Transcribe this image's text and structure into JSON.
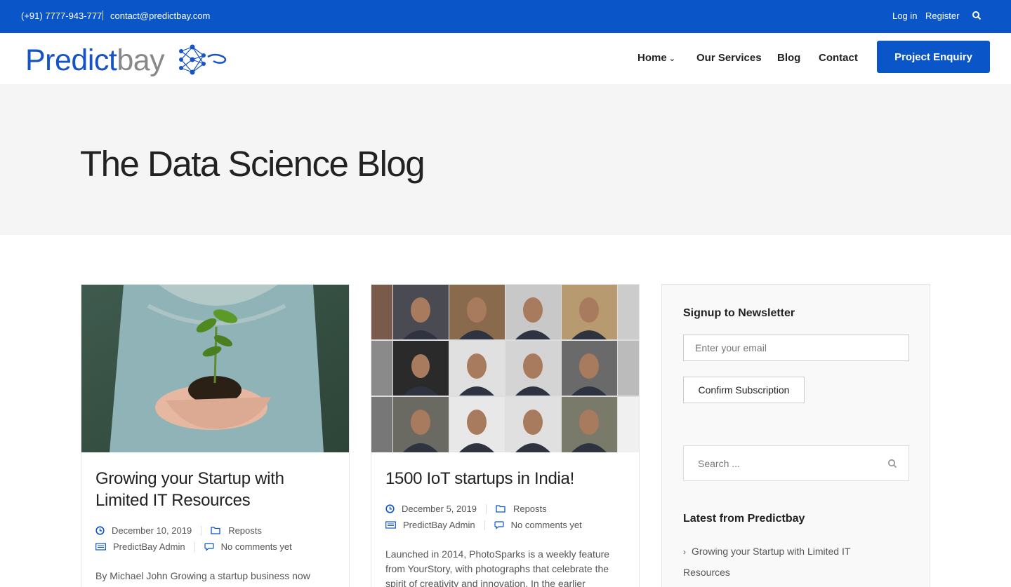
{
  "topbar": {
    "phone": "(+91) 7777-943-777",
    "email": "contact@predictbay.com",
    "login": "Log in",
    "register": "Register"
  },
  "header": {
    "logo_part1": "Predict",
    "logo_part2": "bay",
    "nav": {
      "home": "Home",
      "services": "Our Services",
      "blog": "Blog",
      "contact": "Contact"
    },
    "cta": "Project Enquiry"
  },
  "hero": {
    "title": "The Data Science Blog"
  },
  "posts": [
    {
      "title": "Growing your Startup with Limited IT Resources",
      "date": "December 10, 2019",
      "category": "Reposts",
      "author": "PredictBay Admin",
      "comments": "No comments yet",
      "excerpt": "By Michael John Growing a startup business now"
    },
    {
      "title": "1500 IoT startups in India!",
      "date": "December 5, 2019",
      "category": "Reposts",
      "author": "PredictBay Admin",
      "comments": "No comments yet",
      "excerpt": "Launched in 2014, PhotoSparks is a weekly feature from YourStory, with photographs that celebrate the spirit of creativity and innovation. In the earlier"
    }
  ],
  "sidebar": {
    "newsletter_title": "Signup to Newsletter",
    "email_placeholder": "Enter your email",
    "confirm_label": "Confirm Subscription",
    "search_placeholder": "Search ...",
    "latest_title": "Latest from Predictbay",
    "latest_items": [
      "Growing your Startup with Limited IT Resources"
    ]
  },
  "colors": {
    "brand_blue": "#0a55c8",
    "hero_bg": "#f5f5f5"
  }
}
